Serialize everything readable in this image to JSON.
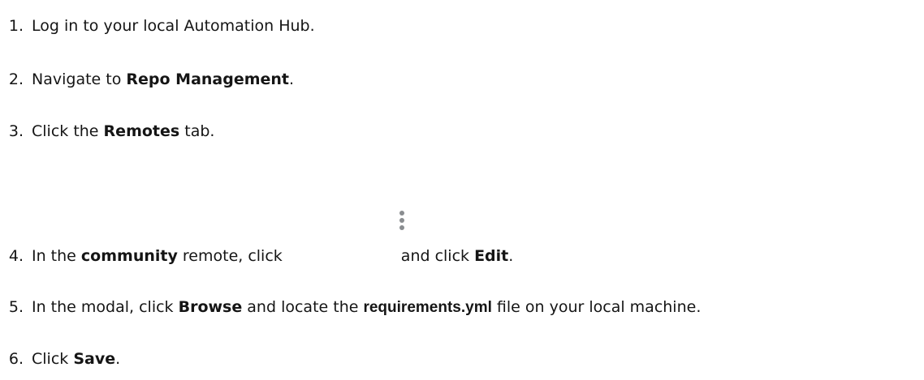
{
  "steps": [
    {
      "num": "1.",
      "parts": [
        "Log in to your local Automation Hub."
      ]
    },
    {
      "num": "2.",
      "parts": [
        "Navigate to ",
        "Repo Management",
        "."
      ]
    },
    {
      "num": "3.",
      "parts": [
        "Click the ",
        "Remotes",
        " tab."
      ]
    },
    {
      "num": "4.",
      "parts": [
        "In the ",
        "community",
        " remote, click",
        "and click ",
        "Edit",
        "."
      ]
    },
    {
      "num": "5.",
      "parts": [
        "In the modal, click ",
        "Browse",
        " and locate the ",
        "requirements.yml",
        " file on your local machine."
      ]
    },
    {
      "num": "6.",
      "parts": [
        "Click ",
        "Save",
        "."
      ]
    }
  ],
  "icons": {
    "kebab": "kebab-menu-icon"
  }
}
